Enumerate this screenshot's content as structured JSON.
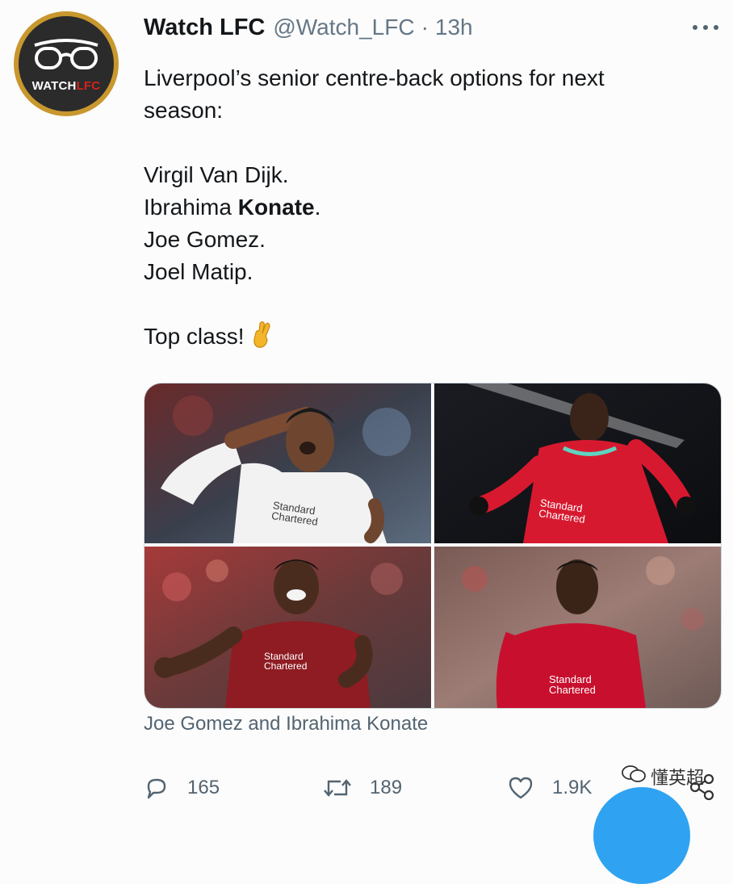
{
  "account": {
    "name": "Watch LFC",
    "handle": "@Watch_LFC",
    "separator": "·",
    "time": "13h",
    "avatar_text_main": "WATCH",
    "avatar_text_accent": "LFC"
  },
  "tweet": {
    "intro_line1": "Liverpool’s senior centre-back options for next",
    "intro_line2": "season:",
    "players": {
      "p1": "Virgil Van Dijk.",
      "p2_first": "Ibrahima ",
      "p2_bold": "Konate",
      "p2_end": ".",
      "p3": "Joe Gomez.",
      "p4": "Joel Matip."
    },
    "closing": "Top class!",
    "closing_emoji": "crossed-fingers-emoji"
  },
  "media": {
    "photos": [
      {
        "name": "van-dijk-photo",
        "sponsor_line1": "Standard",
        "sponsor_line2": "Chartered",
        "kit_color": "#f2f2f2"
      },
      {
        "name": "konate-photo",
        "sponsor_line1": "Standard",
        "sponsor_line2": "Chartered",
        "kit_color": "#d7192f"
      },
      {
        "name": "gomez-photo",
        "sponsor_line1": "Standard",
        "sponsor_line2": "Chartered",
        "kit_color": "#8e1c22"
      },
      {
        "name": "matip-photo",
        "sponsor_line1": "Standard",
        "sponsor_line2": "Chartered",
        "kit_color": "#c8102e"
      }
    ],
    "caption": "Joe Gomez and Ibrahima Konate"
  },
  "actions": {
    "replies": "165",
    "retweets": "189",
    "likes": "1.9K"
  },
  "watermark": {
    "text": "懂英超"
  },
  "colors": {
    "text_primary": "#14171a",
    "text_secondary": "#536471",
    "accent_blue": "#1d9bf0",
    "avatar_ring": "#c8972e",
    "lfc_red": "#d4231b"
  }
}
